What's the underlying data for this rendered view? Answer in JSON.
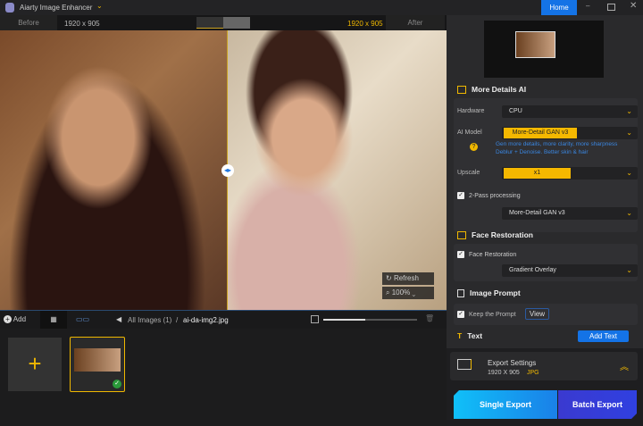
{
  "app": {
    "title": "Aiarty Image Enhancer",
    "home": "Home"
  },
  "compare": {
    "before": "Before",
    "before_res": "1920 x 905",
    "after_res": "1920 x 905",
    "after": "After"
  },
  "viewer": {
    "refresh": "Refresh",
    "zoom": "100%"
  },
  "toolbar": {
    "add": "Add",
    "breadcrumb_all": "All Images (1)",
    "sep": "/",
    "filename": "ai-da-img2.jpg",
    "slider_value": 0.45
  },
  "panel": {
    "more_details": {
      "title": "More Details AI",
      "hardware_label": "Hardware",
      "hardware": "CPU",
      "model_label": "AI Model",
      "model": "More-Detail GAN  v3",
      "desc1": "Gen more details, more clarity, more sharpness",
      "desc2": "Deblur + Denoise. Better skin & hair",
      "upscale_label": "Upscale",
      "upscale": "x1",
      "two_pass": "2-Pass processing",
      "two_pass_model": "More-Detail GAN  v3"
    },
    "face": {
      "title": "Face Restoration",
      "check": "Face Restoration",
      "mode": "Gradient Overlay"
    },
    "prompt": {
      "title": "Image Prompt",
      "check": "Keep the Prompt",
      "view": "View"
    },
    "text": {
      "title": "Text",
      "add": "Add Text"
    },
    "export": {
      "title": "Export Settings",
      "res": "1920 X 905",
      "format": "JPG",
      "single": "Single Export",
      "batch": "Batch Export"
    }
  }
}
